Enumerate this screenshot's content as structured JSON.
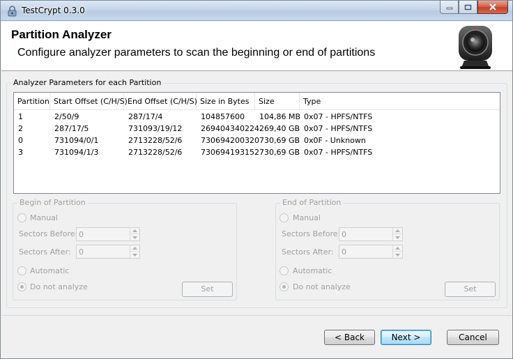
{
  "window": {
    "title": "TestCrypt 0.3.0",
    "accent": "#3c7fb1"
  },
  "header": {
    "title": "Partition Analyzer",
    "subtitle": "Configure analyzer parameters to scan the beginning or end of partitions"
  },
  "params_group": {
    "caption": "Analyzer Parameters for each Partition"
  },
  "table": {
    "columns": [
      "Partition",
      "Start Offset (C/H/S)",
      "End Offset (C/H/S)",
      "Size in Bytes",
      "Size",
      "Type"
    ],
    "rows": [
      [
        "1",
        "2/50/9",
        "287/17/4",
        "104857600",
        "104,86 MB",
        "0x07 - HPFS/NTFS"
      ],
      [
        "2",
        "287/17/5",
        "731093/19/12",
        "269404340224",
        "269,40 GB",
        "0x07 - HPFS/NTFS"
      ],
      [
        "0",
        "731094/0/1",
        "2713228/52/6",
        "730694200320",
        "730,69 GB",
        "0x0F - Unknown"
      ],
      [
        "3",
        "731094/1/3",
        "2713228/52/6",
        "730694193152",
        "730,69 GB",
        "0x07 - HPFS/NTFS"
      ]
    ]
  },
  "begin_group": {
    "caption": "Begin of Partition",
    "manual_label": "Manual",
    "sectors_before_label": "Sectors Before:",
    "sectors_before_value": "0",
    "sectors_after_label": "Sectors After:",
    "sectors_after_value": "0",
    "automatic_label": "Automatic",
    "do_not_analyze_label": "Do not analyze",
    "selected": "do_not_analyze",
    "set_label": "Set"
  },
  "end_group": {
    "caption": "End of Partition",
    "manual_label": "Manual",
    "sectors_before_label": "Sectors Before:",
    "sectors_before_value": "0",
    "sectors_after_label": "Sectors After:",
    "sectors_after_value": "0",
    "automatic_label": "Automatic",
    "do_not_analyze_label": "Do not analyze",
    "selected": "do_not_analyze",
    "set_label": "Set"
  },
  "footer": {
    "back_label": "< Back",
    "next_label": "Next >",
    "cancel_label": "Cancel"
  }
}
